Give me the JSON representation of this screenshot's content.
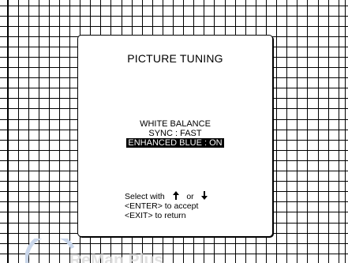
{
  "dialog": {
    "title": "PICTURE TUNING",
    "items": [
      {
        "label": "WHITE BALANCE",
        "selected": false
      },
      {
        "label": "SYNC : FAST",
        "selected": false
      },
      {
        "label": "ENHANCED BLUE : ON",
        "selected": true
      }
    ],
    "help": {
      "select_prefix": "Select with",
      "or_text": "or",
      "up_icon": "arrow-up-icon",
      "down_icon": "arrow-down-icon",
      "enter_line": "<ENTER> to accept",
      "exit_line": "<EXIT> to return"
    }
  },
  "watermark": {
    "text": "ReMan Plus"
  },
  "colors": {
    "grid_line": "#000000",
    "background": "#ffffff",
    "selection_bg": "#000000",
    "selection_fg": "#ffffff"
  }
}
